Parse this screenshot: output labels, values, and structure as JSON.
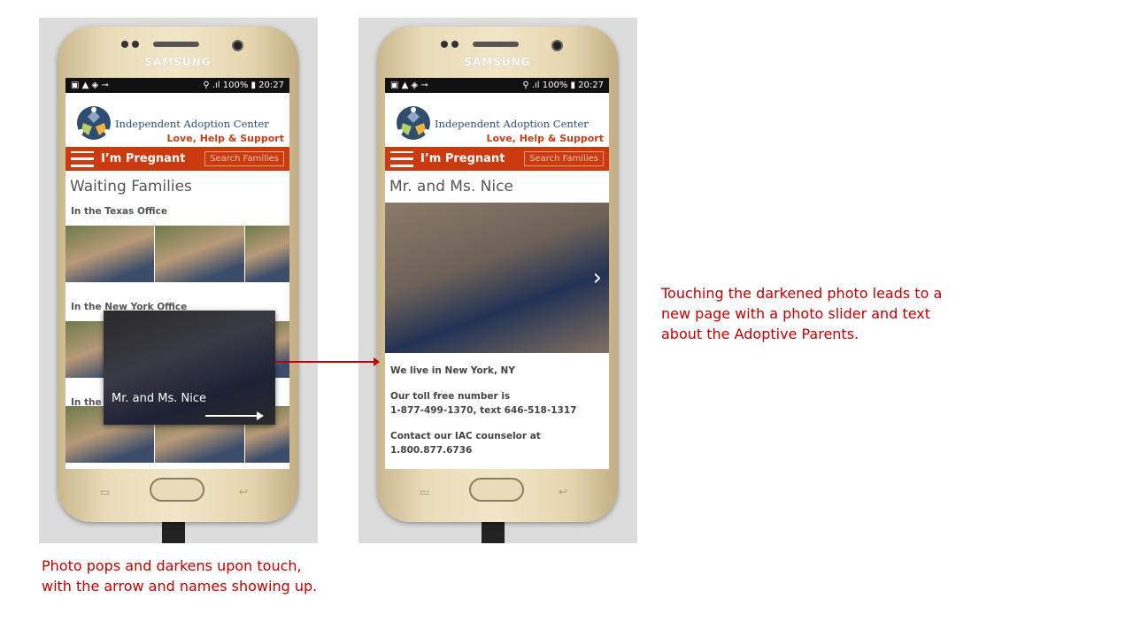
{
  "status": {
    "left_icons": "▣ ▲ ◈ ⊸",
    "right": "⚲ .ıl 100% ▮ 20:27"
  },
  "brand": "SAMSUNG",
  "site": {
    "name": "Independent Adoption Center",
    "tagline": "Love, Help & Support",
    "nav_title": "I’m Pregnant",
    "search_label": "Search Families"
  },
  "left_screen": {
    "title": "Waiting Families",
    "sections": [
      "In the Texas Office",
      "In the New York Office",
      "In the"
    ],
    "overlay_name": "Mr. and Ms. Nice"
  },
  "right_screen": {
    "title": "Mr. and Ms. Nice",
    "lines": [
      "We live in New York, NY",
      "Our toll free number is",
      "1-877-499-1370, text 646-518-1317",
      "Contact our IAC counselor at",
      "1.800.877.6736"
    ]
  },
  "captions": {
    "left": [
      "Photo pops and darkens upon touch,",
      "with the arrow and names showing up."
    ],
    "right": [
      "Touching the darkened photo leads to a",
      "new page with a photo slider and text",
      "about the Adoptive Parents."
    ]
  }
}
